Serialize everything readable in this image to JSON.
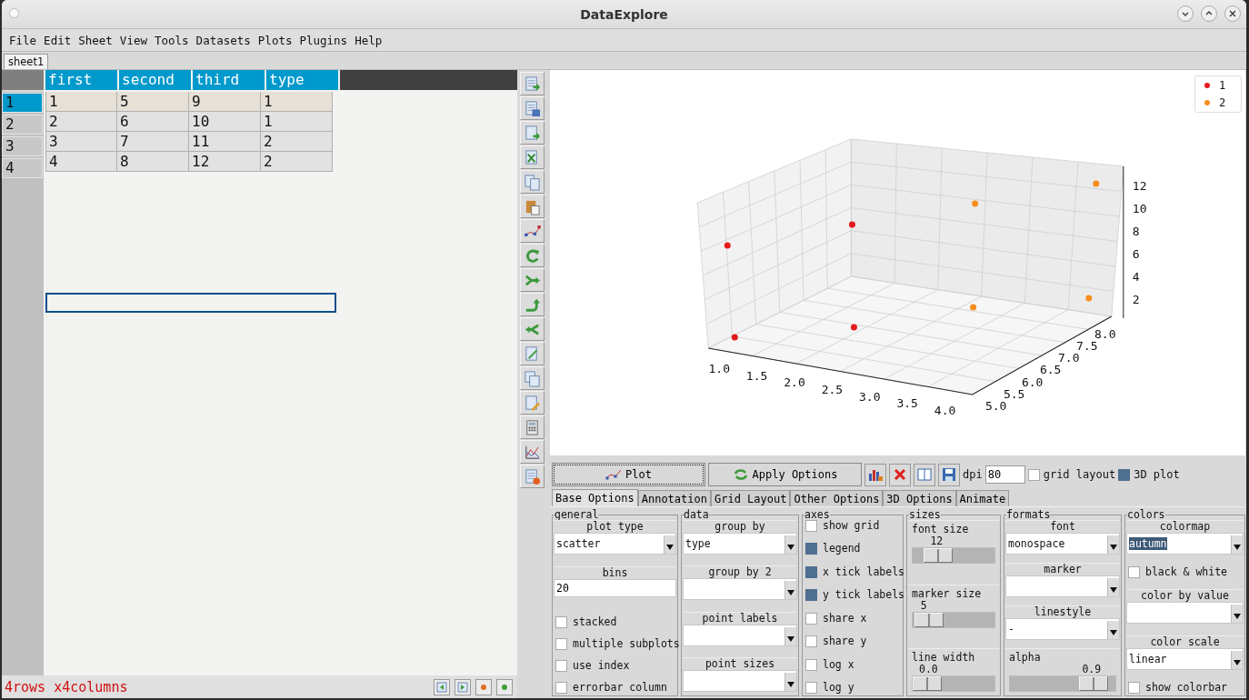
{
  "window": {
    "title": "DataExplore"
  },
  "menu": [
    "File",
    "Edit",
    "Sheet",
    "View",
    "Tools",
    "Datasets",
    "Plots",
    "Plugins",
    "Help"
  ],
  "sheet_tabs": [
    {
      "label": "sheet1",
      "selected": true
    }
  ],
  "table": {
    "columns": [
      "first",
      "second",
      "third",
      "type"
    ],
    "rows": [
      {
        "label": "1",
        "selected": true,
        "cells": [
          "1",
          "5",
          "9",
          "1"
        ]
      },
      {
        "label": "2",
        "selected": false,
        "cells": [
          "2",
          "6",
          "10",
          "1"
        ]
      },
      {
        "label": "3",
        "selected": false,
        "cells": [
          "3",
          "7",
          "11",
          "2"
        ]
      },
      {
        "label": "4",
        "selected": false,
        "cells": [
          "4",
          "8",
          "12",
          "2"
        ]
      }
    ]
  },
  "status_bar": {
    "text": "4rows x4columns"
  },
  "plot": {
    "legend": [
      {
        "label": "1",
        "color": "#e41a1c"
      },
      {
        "label": "2",
        "color": "#f68e1e"
      }
    ],
    "x_ticks": [
      "1.0",
      "1.5",
      "2.0",
      "2.5",
      "3.0",
      "3.5",
      "4.0"
    ],
    "y_ticks": [
      "5.0",
      "5.5",
      "6.0",
      "6.5",
      "7.0",
      "7.5",
      "8.0"
    ],
    "z_ticks": [
      "12",
      "10",
      "8",
      "6",
      "4",
      "2"
    ]
  },
  "plot_toolbar": {
    "plot_button": "Plot",
    "apply_button": "Apply Options",
    "dpi_label": "dpi",
    "dpi_value": "80",
    "checks": [
      {
        "label": "grid layout",
        "checked": false
      },
      {
        "label": "3D plot",
        "checked": true
      }
    ]
  },
  "option_tabs": [
    {
      "label": "Base Options",
      "selected": true
    },
    {
      "label": "Annotation",
      "selected": false
    },
    {
      "label": "Grid Layout",
      "selected": false
    },
    {
      "label": "Other Options",
      "selected": false
    },
    {
      "label": "3D Options",
      "selected": false
    },
    {
      "label": "Animate",
      "selected": false
    }
  ],
  "option_groups": [
    {
      "title": "general",
      "controls": [
        {
          "kind": "combo",
          "label": "plot type",
          "value": "scatter",
          "text_selected": false
        },
        {
          "kind": "entry",
          "label": "bins",
          "value": "20"
        },
        {
          "kind": "check",
          "label": "stacked",
          "checked": false
        },
        {
          "kind": "check",
          "label": "multiple subplots",
          "checked": false
        },
        {
          "kind": "check",
          "label": "use index",
          "checked": false
        },
        {
          "kind": "check",
          "label": "errorbar column",
          "checked": false
        }
      ]
    },
    {
      "title": "data",
      "controls": [
        {
          "kind": "combo",
          "label": "group by",
          "value": "type",
          "text_selected": false
        },
        {
          "kind": "combo",
          "label": "group by 2",
          "text_selected": false
        },
        {
          "kind": "combo",
          "label": "point labels",
          "text_selected": false
        },
        {
          "kind": "combo",
          "label": "point sizes",
          "text_selected": false
        }
      ]
    },
    {
      "title": "axes",
      "controls": [
        {
          "kind": "check",
          "label": "show grid",
          "checked": false
        },
        {
          "kind": "check",
          "label": "legend",
          "checked": true
        },
        {
          "kind": "check",
          "label": "x tick labels",
          "checked": true
        },
        {
          "kind": "check",
          "label": "y tick labels",
          "checked": true
        },
        {
          "kind": "check",
          "label": "share x",
          "checked": false
        },
        {
          "kind": "check",
          "label": "share y",
          "checked": false
        },
        {
          "kind": "check",
          "label": "log x",
          "checked": false
        },
        {
          "kind": "check",
          "label": "log y",
          "checked": false
        }
      ]
    },
    {
      "title": "sizes",
      "controls": [
        {
          "kind": "slider",
          "label": "font size",
          "value": "12",
          "level": 0.2
        },
        {
          "kind": "slider",
          "label": "marker size",
          "value": "5",
          "level": 0.03
        },
        {
          "kind": "slider",
          "label": "line width",
          "value": "0.0",
          "level": 0
        }
      ]
    },
    {
      "title": "formats",
      "controls": [
        {
          "kind": "combo",
          "label": "font",
          "value": "monospace",
          "text_selected": false
        },
        {
          "kind": "combo",
          "label": "marker",
          "text_selected": false
        },
        {
          "kind": "combo",
          "label": "linestyle",
          "value": "-",
          "text_selected": false
        },
        {
          "kind": "slider",
          "label": "alpha",
          "value": "0.9",
          "level": 0.9
        }
      ]
    },
    {
      "title": "colors",
      "controls": [
        {
          "kind": "combo",
          "label": "colormap",
          "value": "autumn",
          "text_selected": true
        },
        {
          "kind": "check",
          "label": "black & white",
          "checked": false
        },
        {
          "kind": "combo",
          "label": "color by value",
          "text_selected": false
        },
        {
          "kind": "combo",
          "label": "color scale",
          "value": "linear",
          "text_selected": false
        },
        {
          "kind": "check",
          "label": "show colorbar",
          "checked": false
        }
      ]
    }
  ]
}
